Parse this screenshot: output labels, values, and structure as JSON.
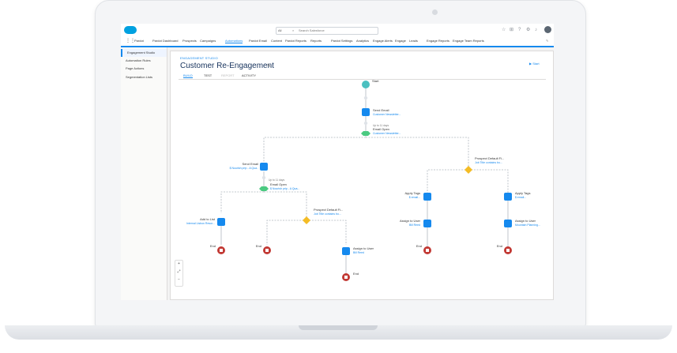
{
  "search": {
    "scope": "All",
    "placeholder": "Search Salesforce"
  },
  "nav": {
    "app_name": "Pardot",
    "items": [
      "Pardot Dashboard",
      "Prospects",
      "Campaigns",
      "Automations",
      "Pardot Email",
      "Content",
      "Pardot Reports",
      "Reports",
      "Pardot Settings",
      "Analytics",
      "Engage Alerts",
      "Engage",
      "Leads",
      "Engage Reports",
      "Engage Team Reports"
    ],
    "active": "Automations"
  },
  "sidebar": {
    "items": [
      "Engagement Studio",
      "Automation Rules",
      "Page Actions",
      "Segmentation Lists"
    ],
    "active": "Engagement Studio"
  },
  "page": {
    "section": "ENGAGEMENT STUDIO",
    "title": "Customer Re-Engagement",
    "start_label": "Start"
  },
  "tabs": [
    "BUILD",
    "TEST",
    "REPORT",
    "ACTIVITY"
  ],
  "active_tab": "BUILD",
  "flow": {
    "start": "Start",
    "send_email_1": {
      "title": "Send Email",
      "sub": "Customer Newsletter..."
    },
    "wait_1": "Up to 11 days",
    "email_open_1": {
      "title": "Email Open",
      "sub": "Customer Newsletter..."
    },
    "send_email_2": {
      "title": "Send Email",
      "sub": "$ Nourish prip - A Qua.."
    },
    "wait_2": "Up to 11 days",
    "email_open_2": {
      "title": "Email Open",
      "sub": "$ Nourish prip - A Qua..."
    },
    "prospect_default_1": {
      "title": "Prospect Default Fi...",
      "sub": "Job Title contains bo..."
    },
    "prospect_default_2": {
      "title": "Prospect Default Fi...",
      "sub": "Job Title contains bo..."
    },
    "add_to_list": {
      "title": "Add to List",
      "sub": "Internal Lisbon Resor..."
    },
    "assign_user_mid": {
      "title": "Assign to User",
      "sub": "Bill Reed"
    },
    "apply_tags_1": {
      "title": "Apply Tags",
      "sub": "$ email..."
    },
    "apply_tags_2": {
      "title": "Apply Tags",
      "sub": "$ email..."
    },
    "assign_user_1": {
      "title": "Assign to User",
      "sub": "Bill Reed"
    },
    "assign_user_2": {
      "title": "Assign to User",
      "sub": "Mountain Planning..."
    },
    "end": "End"
  },
  "zoom": {
    "plus": "+",
    "fit": "⤢",
    "minus": "−"
  },
  "colors": {
    "accent": "#1589ee",
    "action": "#1589ee",
    "trigger": "#4bca81",
    "rule": "#f4bc25",
    "end": "#c23934",
    "start": "#4bc0c0"
  }
}
